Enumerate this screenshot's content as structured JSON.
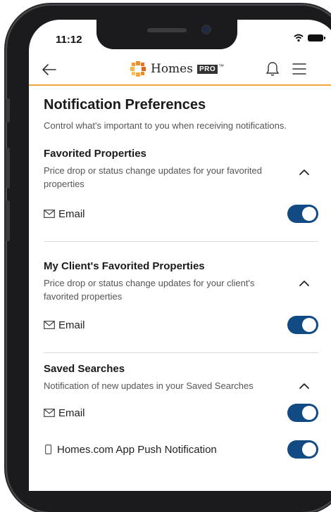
{
  "status_bar": {
    "time": "11:12"
  },
  "header": {
    "logo_text": "Homes",
    "logo_badge": "PRO",
    "trademark": "™"
  },
  "page": {
    "title": "Notification Preferences",
    "description": "Control what's important to you when receiving notifications."
  },
  "sections": [
    {
      "title": "Favorited Properties",
      "description": "Price drop or status change updates for your favorited properties",
      "channels": [
        {
          "label": "Email",
          "icon": "envelope-icon",
          "enabled": true
        }
      ]
    },
    {
      "title": "My Client's Favorited Properties",
      "description": "Price drop or status change updates for your client's favorited properties",
      "channels": [
        {
          "label": "Email",
          "icon": "envelope-icon",
          "enabled": true
        }
      ]
    },
    {
      "title": "Saved Searches",
      "description": "Notification of new updates in your Saved Searches",
      "channels": [
        {
          "label": "Email",
          "icon": "envelope-icon",
          "enabled": true
        },
        {
          "label": "Homes.com App Push Notification",
          "icon": "phone-icon",
          "enabled": true
        }
      ]
    }
  ],
  "colors": {
    "accent": "#f0a53a",
    "toggle_on": "#124a84",
    "logo_orange": "#f28c1e"
  }
}
